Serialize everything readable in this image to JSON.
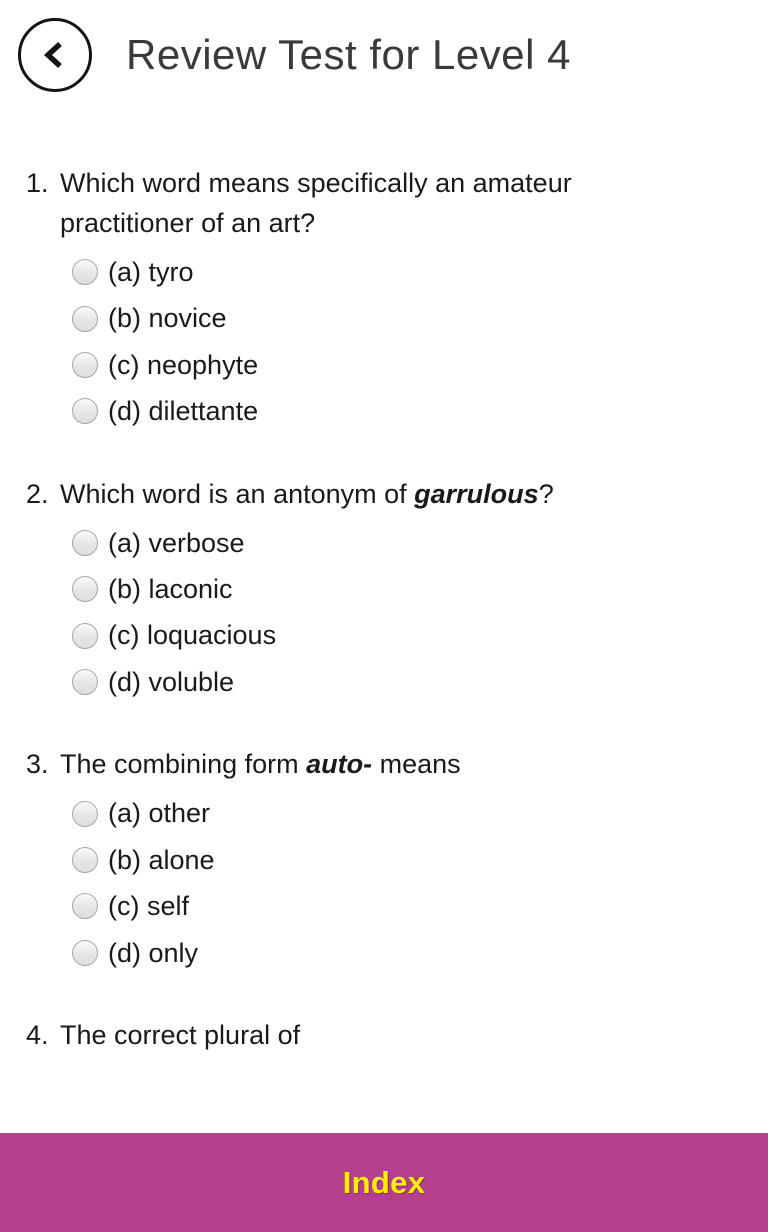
{
  "header": {
    "back_icon": "chevron-left-icon",
    "title": "Review Test for Level 4"
  },
  "colors": {
    "bottom_bar_bg": "#b43f8d",
    "bottom_bar_text": "#ffee00",
    "title_text": "#3a3a3a",
    "body_text": "#1a1a1a",
    "radio_border": "#a8a8a8",
    "page_bg": "#ffffff"
  },
  "quiz": {
    "questions": [
      {
        "number": "1.",
        "text_before": "Which word means specifically an amateur practitioner of an art?",
        "emphasis": "",
        "text_after": "",
        "options": [
          {
            "label": "(a) tyro",
            "selected": false
          },
          {
            "label": "(b) novice",
            "selected": false
          },
          {
            "label": "(c) neophyte",
            "selected": false
          },
          {
            "label": "(d) dilettante",
            "selected": false
          }
        ]
      },
      {
        "number": "2.",
        "text_before": "Which word is an antonym of ",
        "emphasis": "garrulous",
        "text_after": "?",
        "options": [
          {
            "label": "(a) verbose",
            "selected": false
          },
          {
            "label": "(b) laconic",
            "selected": false
          },
          {
            "label": "(c) loquacious",
            "selected": false
          },
          {
            "label": "(d) voluble",
            "selected": false
          }
        ]
      },
      {
        "number": "3.",
        "text_before": "The combining form ",
        "emphasis": "auto-",
        "text_after": " means",
        "options": [
          {
            "label": "(a) other",
            "selected": false
          },
          {
            "label": "(b) alone",
            "selected": false
          },
          {
            "label": "(c) self",
            "selected": false
          },
          {
            "label": "(d) only",
            "selected": false
          }
        ]
      },
      {
        "number": "4.",
        "text_before": "The correct plural of",
        "emphasis": "",
        "text_after": "",
        "options": []
      }
    ]
  },
  "bottom_bar": {
    "label": "Index"
  }
}
